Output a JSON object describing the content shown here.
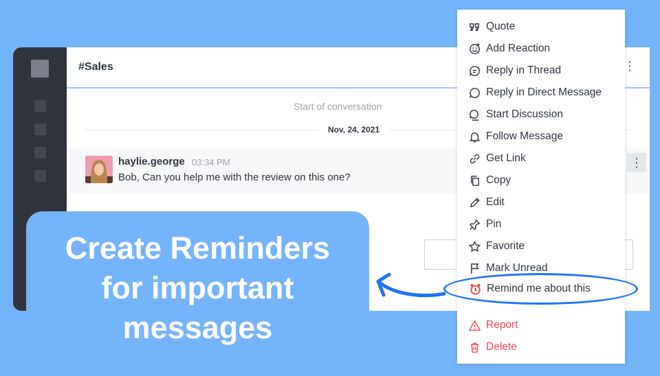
{
  "channel": {
    "title": "#Sales"
  },
  "conversation": {
    "start_label": "Start of conversation",
    "date": "Nov, 24, 2021"
  },
  "message": {
    "username": "haylie.george",
    "time": "03:34 PM",
    "text": "Bob, Can you help me with the review on this one?"
  },
  "menu": {
    "items": [
      {
        "label": "Quote",
        "icon": "quote-icon"
      },
      {
        "label": "Add Reaction",
        "icon": "emoji-add-icon"
      },
      {
        "label": "Reply in Thread",
        "icon": "thread-icon"
      },
      {
        "label": "Reply in Direct Message",
        "icon": "chat-bubble-icon"
      },
      {
        "label": "Start Discussion",
        "icon": "discussion-icon"
      },
      {
        "label": "Follow Message",
        "icon": "bell-icon"
      },
      {
        "label": "Get Link",
        "icon": "link-icon"
      },
      {
        "label": "Copy",
        "icon": "copy-icon"
      },
      {
        "label": "Edit",
        "icon": "pencil-icon"
      },
      {
        "label": "Pin",
        "icon": "pin-icon"
      },
      {
        "label": "Favorite",
        "icon": "star-icon"
      },
      {
        "label": "Mark Unread",
        "icon": "flag-icon"
      },
      {
        "label": "Remind me about this",
        "icon": "alarm-clock-icon"
      },
      {
        "label": "Report",
        "icon": "warning-icon"
      },
      {
        "label": "Delete",
        "icon": "trash-icon"
      }
    ]
  },
  "callout": {
    "lines": [
      "Create Reminders",
      "for important",
      "messages"
    ]
  },
  "colors": {
    "background": "#74b4fb",
    "accent": "#1d74f5",
    "danger": "#f5455c",
    "rail": "#2f343d"
  }
}
